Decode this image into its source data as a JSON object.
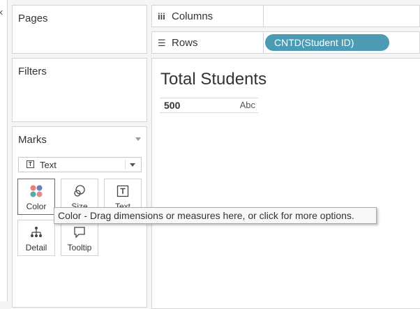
{
  "left_strip": {
    "close_glyph": "×"
  },
  "pages": {
    "title": "Pages"
  },
  "filters": {
    "title": "Filters"
  },
  "marks": {
    "title": "Marks",
    "mark_type": {
      "icon": "text-mark-icon",
      "icon_glyph": "T",
      "value": "Text"
    },
    "buttons": [
      {
        "label": "Color",
        "icon": "color-icon"
      },
      {
        "label": "Size",
        "icon": "size-icon"
      },
      {
        "label": "Text",
        "icon": "text-icon"
      },
      {
        "label": "Detail",
        "icon": "detail-icon"
      },
      {
        "label": "Tooltip",
        "icon": "tooltip-icon"
      }
    ]
  },
  "columns_shelf": {
    "icon": "columns-icon",
    "icon_glyph": "iii",
    "label": "Columns"
  },
  "rows_shelf": {
    "icon": "rows-icon",
    "icon_glyph": "☰",
    "label": "Rows",
    "pill": "CNTD(Student ID)",
    "pill_color": "#4a9bb3"
  },
  "view": {
    "title": "Total Students",
    "row_header": "500",
    "row_cell": "Abc"
  },
  "tooltip": {
    "text": "Color - Drag dimensions or measures here, or click for more options."
  },
  "colors": {
    "color_dots": [
      "#e8807a",
      "#6b7fb8",
      "#5aa9a6",
      "#e38a8a"
    ]
  }
}
